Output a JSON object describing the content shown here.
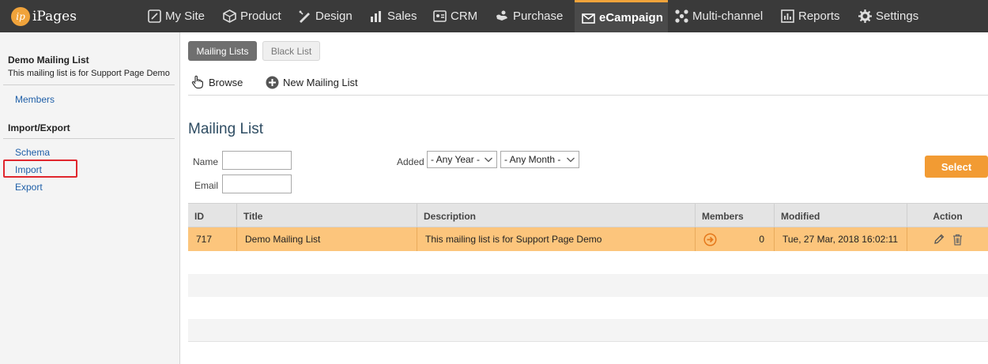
{
  "app": {
    "name": "iPages",
    "logo_mark": "ip"
  },
  "nav": {
    "items": [
      {
        "label": "My Site",
        "icon": "my-site-icon"
      },
      {
        "label": "Product",
        "icon": "product-icon"
      },
      {
        "label": "Design",
        "icon": "design-icon"
      },
      {
        "label": "Sales",
        "icon": "sales-icon"
      },
      {
        "label": "CRM",
        "icon": "crm-icon"
      },
      {
        "label": "Purchase",
        "icon": "purchase-icon"
      },
      {
        "label": "eCampaign",
        "icon": "ecampaign-icon",
        "active": true
      },
      {
        "label": "Multi-channel",
        "icon": "multi-channel-icon"
      },
      {
        "label": "Reports",
        "icon": "reports-icon"
      },
      {
        "label": "Settings",
        "icon": "gear-icon"
      }
    ]
  },
  "sidebar": {
    "title": "Demo Mailing List",
    "description": "This mailing list is for Support Page Demo",
    "members_link": "Members",
    "section_title": "Import/Export",
    "links": [
      "Schema",
      "Import",
      "Export"
    ],
    "highlighted_link": "Import"
  },
  "tabs": {
    "active": "Mailing Lists",
    "inactive": "Black List"
  },
  "toolbar": {
    "browse": "Browse",
    "new_list": "New Mailing List"
  },
  "main": {
    "heading": "Mailing List",
    "filters": {
      "name_label": "Name",
      "email_label": "Email",
      "added_label": "Added",
      "year_value": "- Any Year -",
      "month_value": "- Any Month -",
      "name_value": "",
      "email_value": ""
    },
    "select_button": "Select"
  },
  "table": {
    "columns": [
      "ID",
      "Title",
      "Description",
      "Members",
      "Modified",
      "Action"
    ],
    "rows": [
      {
        "id": "717",
        "title": "Demo Mailing List",
        "description": "This mailing list is for Support Page Demo",
        "members": "0",
        "modified": "Tue, 27 Mar, 2018 16:02:11"
      }
    ]
  },
  "colors": {
    "topbar": "#3a3a3a",
    "accent": "#f0a33b",
    "select_button": "#f29b33",
    "selected_row": "#fcc57c",
    "link": "#1f5fa8",
    "highlight_box": "#e0262d"
  }
}
